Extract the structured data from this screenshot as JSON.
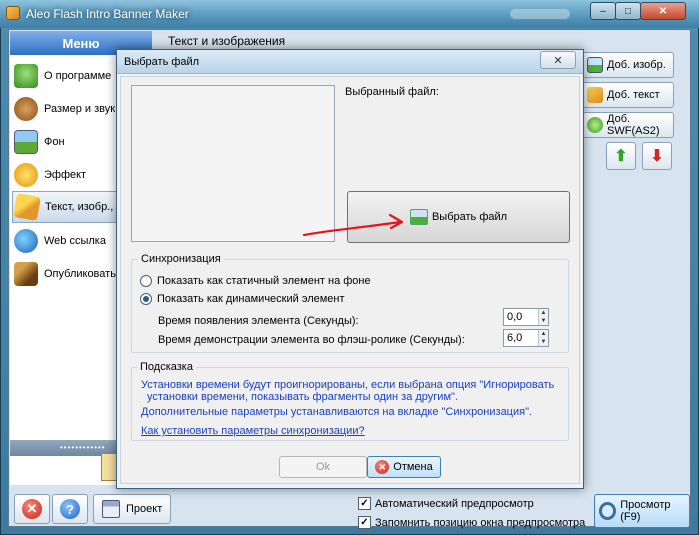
{
  "window": {
    "title": "Aleo Flash Intro Banner Maker",
    "minimize_glyph": "‒",
    "maximize_glyph": "□",
    "close_glyph": "✕"
  },
  "sidebar": {
    "header": "Меню",
    "items": [
      {
        "label": "О программе",
        "icon": "home-icon"
      },
      {
        "label": "Размер и звук",
        "icon": "cookie-icon"
      },
      {
        "label": "Фон",
        "icon": "picture-icon"
      },
      {
        "label": "Эффект",
        "icon": "effect-icon"
      },
      {
        "label": "Текст, изобр., SWF",
        "icon": "pencil-icon",
        "selected": true
      },
      {
        "label": "Web ссылка",
        "icon": "globe-icon"
      },
      {
        "label": "Опубликовать баннер",
        "icon": "brush-icon"
      }
    ]
  },
  "content": {
    "title": "Текст и изображения",
    "add_image": "Доб. изобр.",
    "add_text": "Доб. текст",
    "add_swf": "Доб. SWF(AS2)",
    "move_up_glyph": "⬆",
    "move_down_glyph": "⬇"
  },
  "bottom": {
    "stop_glyph": "✕",
    "help_glyph": "?",
    "project_label": "Проект",
    "auto_preview": "Автоматический предпросмотр",
    "remember_position": "Запомнить позицию окна предпросмотра",
    "check_glyph": "✓",
    "preview_label": "Просмотр (F9)"
  },
  "dialog": {
    "title": "Выбрать файл",
    "close_glyph": "✕",
    "selected_file_label": "Выбранный файл:",
    "choose_file_button": "Выбрать файл",
    "sync": {
      "legend": "Синхронизация",
      "option_static": "Показать как статичный элемент на фоне",
      "option_dynamic": "Показать как динамический элемент",
      "appear_time_label": "Время появления элемента (Секунды):",
      "appear_time_value": "0,0",
      "show_time_label": "Время демонстрации элемента во флэш-ролике (Секунды):",
      "show_time_value": "6,0",
      "spin_up_glyph": "▲",
      "spin_down_glyph": "▼"
    },
    "hint": {
      "legend": "Подсказка",
      "line1": "Установки времени будут проигнорированы, если выбрана опция \"Игнорировать",
      "line2": "установки времени, показывать фрагменты один за другим\".",
      "line3": "Дополнительные параметры устанавливаются на вкладке \"Синхронизация\".",
      "link": "Как установить параметры синхронизации?"
    },
    "ok_label": "Ok",
    "cancel_label": "Отмена",
    "cancel_glyph": "✕"
  },
  "colors": {
    "annotation_arrow": "#e8141a",
    "hint_text": "#1a40c0"
  }
}
